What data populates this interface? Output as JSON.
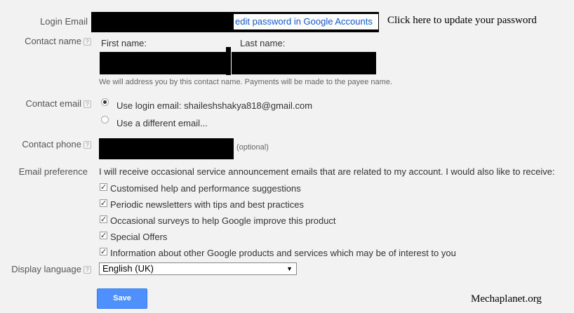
{
  "login": {
    "label": "Login Email",
    "link": "edit password in Google Accounts",
    "annotation": "Click here to update your password"
  },
  "contact_name": {
    "label": "Contact name",
    "first_label": "First name:",
    "last_label": "Last name:",
    "hint": "We will address you by this contact name. Payments will be made to the payee name."
  },
  "contact_email": {
    "label": "Contact email",
    "options": [
      "Use login email: shaileshshakya818@gmail.com",
      "Use a different email..."
    ],
    "selected_index": 0
  },
  "contact_phone": {
    "label": "Contact phone",
    "optional": "(optional)"
  },
  "email_pref": {
    "label": "Email preference",
    "intro": "I will receive occasional service announcement emails that are related to my account. I would also like to receive:",
    "items": [
      "Customised help and performance suggestions",
      "Periodic newsletters with tips and best practices",
      "Occasional surveys to help Google improve this product",
      "Special Offers",
      "Information about other Google products and services which may be of interest to you"
    ]
  },
  "display_language": {
    "label": "Display language",
    "value": "English (UK)"
  },
  "save_label": "Save",
  "watermark": "Mechaplanet.org",
  "help_glyph": "?",
  "check_glyph": "✓",
  "arrow_glyph": "▼",
  "colors": {
    "link": "#1155cc",
    "save_button": "#4d90fe",
    "background": "#f2f2f2"
  }
}
